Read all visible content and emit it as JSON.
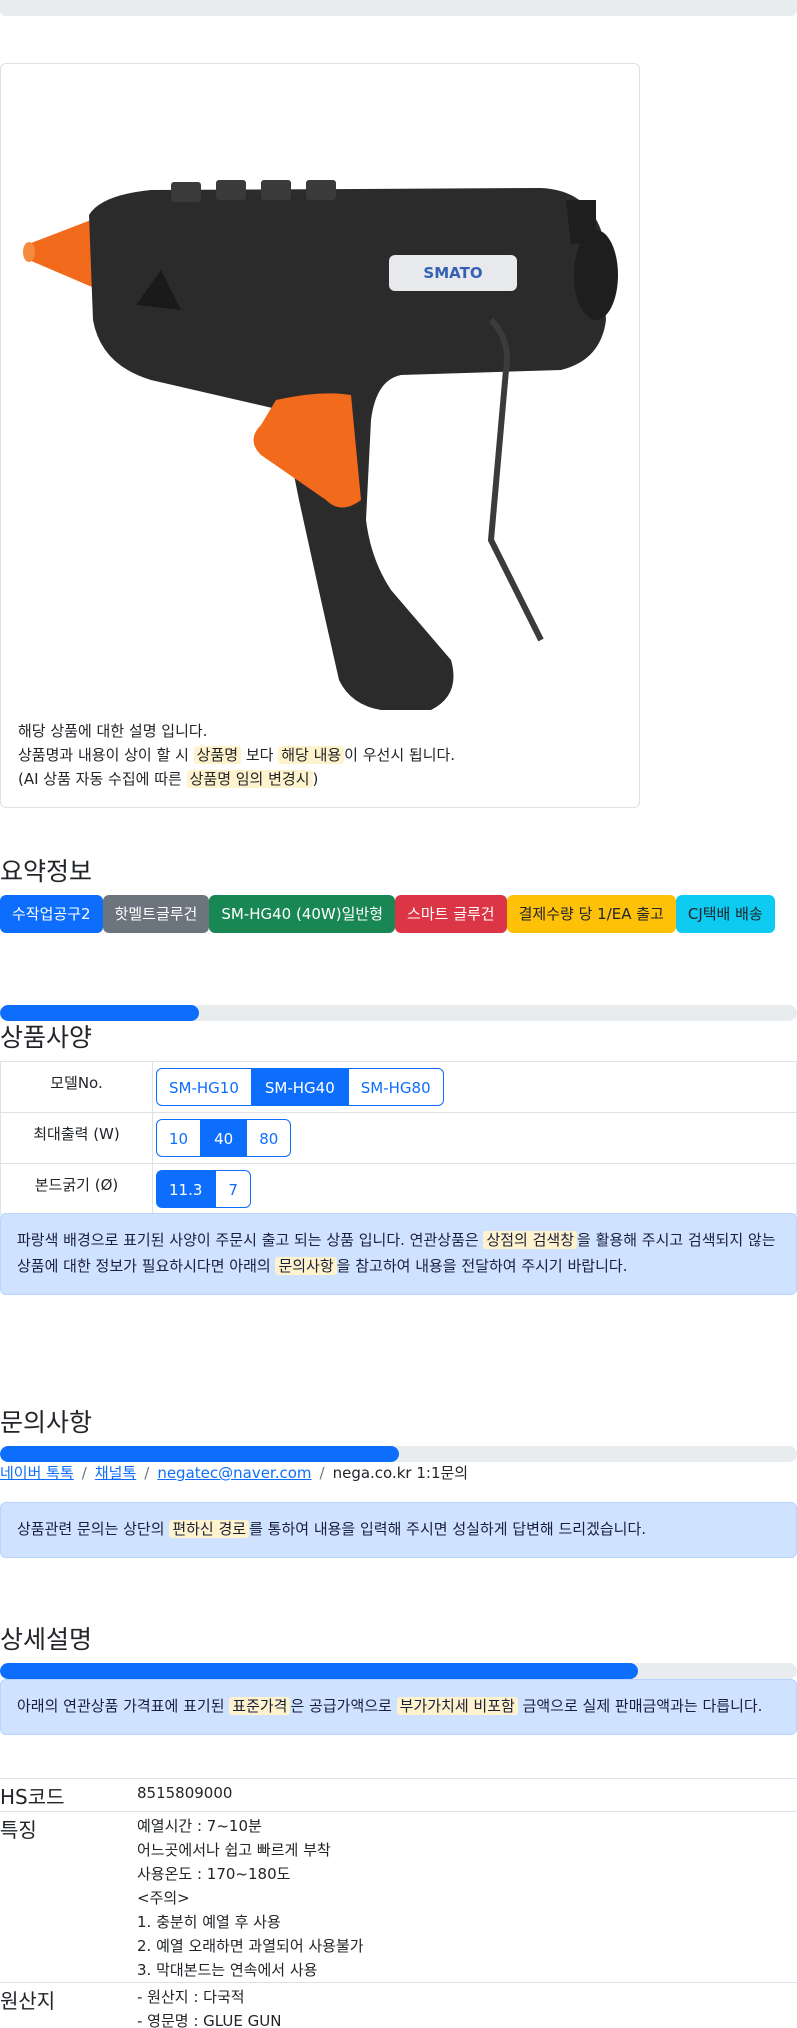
{
  "product": {
    "image_alt": "glue gun",
    "brand_text": "SMATO",
    "desc_line1": "해당 상품에 대한 설명 입니다.",
    "desc_line2_a": "상품명과 내용이 상이 할 시 ",
    "desc_line2_hl1": "상품명",
    "desc_line2_b": " 보다 ",
    "desc_line2_hl2": "해당 내용",
    "desc_line2_c": "이 우선시 됩니다.",
    "desc_line3_a": "(AI 상품 자동 수집에 따른 ",
    "desc_line3_hl": "상품명 임의 변경시",
    "desc_line3_b": ")"
  },
  "summary": {
    "title": "요약정보",
    "badges": [
      "수작업공구2",
      "핫멜트글루건",
      "SM-HG40 (40W)일반형",
      "스마트 글루건",
      "결제수량 당 1/EA 출고",
      "CJ택배 배송"
    ]
  },
  "spec": {
    "title": "상품사양",
    "progress_fraction": 0.25,
    "rows": [
      {
        "label": "모델No.",
        "options": [
          "SM-HG10",
          "SM-HG40",
          "SM-HG80"
        ],
        "active": 1
      },
      {
        "label": "최대출력 (W)",
        "options": [
          "10",
          "40",
          "80"
        ],
        "active": 1
      },
      {
        "label": "본드굵기 (Ø)",
        "options": [
          "11.3",
          "7"
        ],
        "active": 0
      }
    ],
    "notice_a": "파랑색 배경으로 표기된 사양이 주문시 출고 되는 상품 입니다. 연관상품은 ",
    "notice_hl1": "상점의 검색창",
    "notice_b": "을 활용해 주시고 검색되지 않는 상품에 대한 정보가 필요하시다면 아래의 ",
    "notice_hl2": "문의사항",
    "notice_c": "을 참고하여 내용을 전달하여 주시기 바랍니다."
  },
  "inquiry": {
    "title": "문의사항",
    "progress_fraction": 0.5,
    "links": [
      "네이버 톡톡",
      "채널톡",
      "negatec@naver.com"
    ],
    "last": "nega.co.kr 1:1문의",
    "sep": "/",
    "notice_a": "상품관련 문의는 상단의 ",
    "notice_hl": "편하신 경로",
    "notice_b": "를 통하여 내용을 입력해 주시면 성실하게 답변해 드리겠습니다."
  },
  "detail": {
    "title": "상세설명",
    "progress_fraction": 0.8,
    "notice_a": "아래의 연관상품 가격표에 표기된 ",
    "notice_hl1": "표준가격",
    "notice_b": "은 공급가액으로 ",
    "notice_hl2": "부가가치세 비포함",
    "notice_c": " 금액으로 실제 판매금액과는 다릅니다.",
    "hs_label": "HS코드",
    "hs_value": "8515809000",
    "feature_label": "특징",
    "features": [
      "예열시간 : 7~10분",
      "어느곳에서나 쉽고 빠르게 부착",
      "사용온도 : 170~180도",
      "<주의>",
      "1. 충분히 예열 후 사용",
      "2. 예열 오래하면 과열되어 사용불가",
      "3. 막대본드는 연속에서 사용"
    ],
    "origin_label": "원산지",
    "origin": [
      "- 원산지 : 다국적",
      "- 영문명 : GLUE GUN"
    ]
  }
}
